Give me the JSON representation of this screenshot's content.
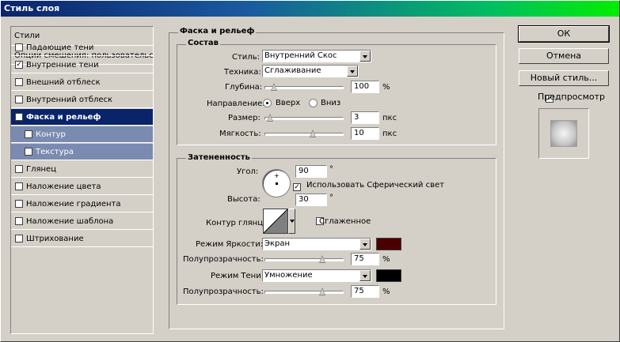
{
  "window": {
    "title": "Стиль слоя"
  },
  "colors": {
    "highlight_color": "#4a0000",
    "shadow_color": "#000000",
    "selection": "#0a246a",
    "sub_item": "#7b8ab0"
  },
  "styles_list": {
    "header": "Стили",
    "blend_options": "Опции смешения: пользовательские",
    "items": [
      {
        "label": "Падающие тени",
        "checked": false
      },
      {
        "label": "Внутренние тени",
        "checked": true
      },
      {
        "label": "Внешний отблеск",
        "checked": false
      },
      {
        "label": "Внутренний отблеск",
        "checked": false
      },
      {
        "label": "Фаска и рельеф",
        "checked": true
      },
      {
        "label": "Контур",
        "checked": false
      },
      {
        "label": "Текстура",
        "checked": false
      },
      {
        "label": "Глянец",
        "checked": false
      },
      {
        "label": "Наложение цвета",
        "checked": false
      },
      {
        "label": "Наложение градиента",
        "checked": false
      },
      {
        "label": "Наложение шаблона",
        "checked": false
      },
      {
        "label": "Штрихование",
        "checked": false
      }
    ],
    "check_mark": "✓"
  },
  "panel": {
    "title": "Фаска и рельеф",
    "structure": {
      "title": "Состав",
      "style_label": "Стиль:",
      "style_value": "Внутренний Скос",
      "technique_label": "Техника:",
      "technique_value": "Сглаживание",
      "depth_label": "Глубина:",
      "depth_value": "100",
      "depth_unit": "%",
      "depth_level": 0.08,
      "direction_label": "Направление:",
      "direction_up": "Вверх",
      "direction_down": "Вниз",
      "size_label": "Размер:",
      "size_value": "3",
      "size_unit": "пкс",
      "size_level": 0.02,
      "soften_label": "Мягкость:",
      "soften_value": "10",
      "soften_unit": "пкс",
      "soften_level": 0.62
    },
    "shading": {
      "title": "Затененность",
      "angle_label": "Угол:",
      "angle_value": "90",
      "angle_unit": "°",
      "global_light_label": "Использовать Сферический свет",
      "global_light_checked": true,
      "altitude_label": "Высота:",
      "altitude_value": "30",
      "altitude_unit": "°",
      "gloss_contour_label": "Контур глянца:",
      "anti_aliased_label": "Сглаженное",
      "anti_aliased_checked": false,
      "highlight_mode_label": "Режим Яркости:",
      "highlight_mode_value": "Экран",
      "highlight_opacity_label": "Полупрозрачность:",
      "highlight_opacity_value": "75",
      "highlight_opacity_unit": "%",
      "highlight_opacity_level": 0.75,
      "shadow_mode_label": "Режим Тени:",
      "shadow_mode_value": "Умножение",
      "shadow_opacity_label": "Полупрозрачность:",
      "shadow_opacity_value": "75",
      "shadow_opacity_unit": "%",
      "shadow_opacity_level": 0.75
    }
  },
  "buttons": {
    "ok": "ОК",
    "cancel": "Отмена",
    "new_style": "Новый стиль...",
    "preview": "Предпросмотр",
    "preview_checked": true
  }
}
